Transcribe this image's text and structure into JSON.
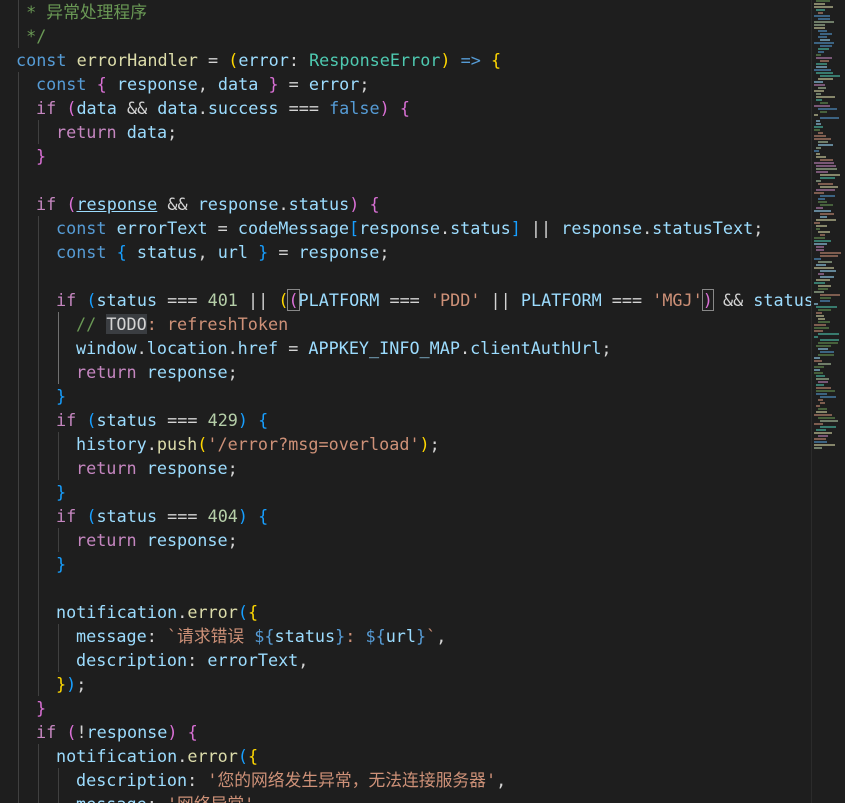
{
  "editor": {
    "lines": [
      {
        "indent": 0,
        "guides": [
          0
        ],
        "tokens": [
          {
            "t": " * 异常处理程序",
            "c": "cm"
          }
        ]
      },
      {
        "indent": 0,
        "guides": [
          0
        ],
        "tokens": [
          {
            "t": " */",
            "c": "cm"
          }
        ]
      },
      {
        "indent": 0,
        "guides": [],
        "tokens": [
          {
            "t": "const",
            "c": "kw"
          },
          {
            "t": " "
          },
          {
            "t": "errorHandler",
            "c": "fn"
          },
          {
            "t": " = "
          },
          {
            "t": "(",
            "c": "p1"
          },
          {
            "t": "error",
            "c": "var"
          },
          {
            "t": ": "
          },
          {
            "t": "ResponseError",
            "c": "type"
          },
          {
            "t": ")",
            "c": "p1"
          },
          {
            "t": " "
          },
          {
            "t": "=>",
            "c": "kw"
          },
          {
            "t": " "
          },
          {
            "t": "{",
            "c": "p1"
          }
        ]
      },
      {
        "indent": 1,
        "guides": [
          0
        ],
        "tokens": [
          {
            "t": "const",
            "c": "kw"
          },
          {
            "t": " "
          },
          {
            "t": "{",
            "c": "p2"
          },
          {
            "t": " "
          },
          {
            "t": "response",
            "c": "var"
          },
          {
            "t": ", "
          },
          {
            "t": "data",
            "c": "var"
          },
          {
            "t": " "
          },
          {
            "t": "}",
            "c": "p2"
          },
          {
            "t": " = "
          },
          {
            "t": "error",
            "c": "var"
          },
          {
            "t": ";"
          }
        ]
      },
      {
        "indent": 1,
        "guides": [
          0
        ],
        "tokens": [
          {
            "t": "if",
            "c": "ctl"
          },
          {
            "t": " "
          },
          {
            "t": "(",
            "c": "p2"
          },
          {
            "t": "data",
            "c": "var"
          },
          {
            "t": " && "
          },
          {
            "t": "data",
            "c": "var"
          },
          {
            "t": "."
          },
          {
            "t": "success",
            "c": "var"
          },
          {
            "t": " === "
          },
          {
            "t": "false",
            "c": "kw"
          },
          {
            "t": ")",
            "c": "p2"
          },
          {
            "t": " "
          },
          {
            "t": "{",
            "c": "p2"
          }
        ]
      },
      {
        "indent": 2,
        "guides": [
          0,
          1
        ],
        "tokens": [
          {
            "t": "return",
            "c": "ctl"
          },
          {
            "t": " "
          },
          {
            "t": "data",
            "c": "var"
          },
          {
            "t": ";"
          }
        ]
      },
      {
        "indent": 1,
        "guides": [
          0
        ],
        "tokens": [
          {
            "t": "}",
            "c": "p2"
          }
        ]
      },
      {
        "indent": 0,
        "guides": [
          0
        ],
        "tokens": []
      },
      {
        "indent": 1,
        "guides": [
          0
        ],
        "tokens": [
          {
            "t": "if",
            "c": "ctl"
          },
          {
            "t": " "
          },
          {
            "t": "(",
            "c": "p2"
          },
          {
            "t": "response",
            "c": "var",
            "u": true
          },
          {
            "t": " && "
          },
          {
            "t": "response",
            "c": "var"
          },
          {
            "t": "."
          },
          {
            "t": "status",
            "c": "var"
          },
          {
            "t": ")",
            "c": "p2"
          },
          {
            "t": " "
          },
          {
            "t": "{",
            "c": "p2"
          }
        ]
      },
      {
        "indent": 2,
        "guides": [
          0,
          1
        ],
        "tokens": [
          {
            "t": "const",
            "c": "kw"
          },
          {
            "t": " "
          },
          {
            "t": "errorText",
            "c": "var"
          },
          {
            "t": " = "
          },
          {
            "t": "codeMessage",
            "c": "var"
          },
          {
            "t": "[",
            "c": "p3"
          },
          {
            "t": "response",
            "c": "var"
          },
          {
            "t": "."
          },
          {
            "t": "status",
            "c": "var"
          },
          {
            "t": "]",
            "c": "p3"
          },
          {
            "t": " || "
          },
          {
            "t": "response",
            "c": "var"
          },
          {
            "t": "."
          },
          {
            "t": "statusText",
            "c": "var"
          },
          {
            "t": ";"
          }
        ]
      },
      {
        "indent": 2,
        "guides": [
          0,
          1
        ],
        "tokens": [
          {
            "t": "const",
            "c": "kw"
          },
          {
            "t": " "
          },
          {
            "t": "{",
            "c": "p3"
          },
          {
            "t": " "
          },
          {
            "t": "status",
            "c": "var"
          },
          {
            "t": ", "
          },
          {
            "t": "url",
            "c": "var"
          },
          {
            "t": " "
          },
          {
            "t": "}",
            "c": "p3"
          },
          {
            "t": " = "
          },
          {
            "t": "response",
            "c": "var"
          },
          {
            "t": ";"
          }
        ]
      },
      {
        "indent": 0,
        "guides": [
          0,
          1
        ],
        "tokens": []
      },
      {
        "indent": 2,
        "guides": [
          0,
          1
        ],
        "tokens": [
          {
            "t": "if",
            "c": "ctl"
          },
          {
            "t": " "
          },
          {
            "t": "(",
            "c": "p3"
          },
          {
            "t": "status",
            "c": "var"
          },
          {
            "t": " === "
          },
          {
            "t": "401",
            "c": "num"
          },
          {
            "t": " || "
          },
          {
            "t": "(",
            "c": "p1"
          },
          {
            "t": "(",
            "c": "p2",
            "m": true
          },
          {
            "t": "PLATFORM",
            "c": "var"
          },
          {
            "t": " === "
          },
          {
            "t": "'PDD'",
            "c": "str"
          },
          {
            "t": " || "
          },
          {
            "t": "PLATFORM",
            "c": "var"
          },
          {
            "t": " === "
          },
          {
            "t": "'MGJ'",
            "c": "str"
          },
          {
            "t": ")",
            "c": "p2",
            "m": true
          },
          {
            "t": " && "
          },
          {
            "t": "status",
            "c": "var"
          },
          {
            "t": " === "
          }
        ]
      },
      {
        "indent": 3,
        "guides": [
          0,
          1,
          2
        ],
        "tokens": [
          {
            "t": "// ",
            "c": "cm"
          },
          {
            "t": "TODO",
            "c": "todo"
          },
          {
            "t": ": refreshToken",
            "c": "str"
          }
        ]
      },
      {
        "indent": 3,
        "guides": [
          0,
          1,
          2
        ],
        "tokens": [
          {
            "t": "window",
            "c": "var"
          },
          {
            "t": "."
          },
          {
            "t": "location",
            "c": "var"
          },
          {
            "t": "."
          },
          {
            "t": "href",
            "c": "var"
          },
          {
            "t": " = "
          },
          {
            "t": "APPKEY_INFO_MAP",
            "c": "var"
          },
          {
            "t": "."
          },
          {
            "t": "clientAuthUrl",
            "c": "var"
          },
          {
            "t": ";"
          }
        ]
      },
      {
        "indent": 3,
        "guides": [
          0,
          1,
          2
        ],
        "tokens": [
          {
            "t": "return",
            "c": "ctl"
          },
          {
            "t": " "
          },
          {
            "t": "response",
            "c": "var"
          },
          {
            "t": ";"
          }
        ]
      },
      {
        "indent": 2,
        "guides": [
          0,
          1
        ],
        "tokens": [
          {
            "t": "}",
            "c": "p3"
          }
        ]
      },
      {
        "indent": 2,
        "guides": [
          0,
          1
        ],
        "tokens": [
          {
            "t": "if",
            "c": "ctl"
          },
          {
            "t": " "
          },
          {
            "t": "(",
            "c": "p3"
          },
          {
            "t": "status",
            "c": "var"
          },
          {
            "t": " === "
          },
          {
            "t": "429",
            "c": "num"
          },
          {
            "t": ")",
            "c": "p3"
          },
          {
            "t": " "
          },
          {
            "t": "{",
            "c": "p3"
          }
        ]
      },
      {
        "indent": 3,
        "guides": [
          0,
          1,
          2
        ],
        "tokens": [
          {
            "t": "history",
            "c": "var"
          },
          {
            "t": "."
          },
          {
            "t": "push",
            "c": "fn"
          },
          {
            "t": "(",
            "c": "p1"
          },
          {
            "t": "'/error?msg=overload'",
            "c": "str"
          },
          {
            "t": ")",
            "c": "p1"
          },
          {
            "t": ";"
          }
        ]
      },
      {
        "indent": 3,
        "guides": [
          0,
          1,
          2
        ],
        "tokens": [
          {
            "t": "return",
            "c": "ctl"
          },
          {
            "t": " "
          },
          {
            "t": "response",
            "c": "var"
          },
          {
            "t": ";"
          }
        ]
      },
      {
        "indent": 2,
        "guides": [
          0,
          1
        ],
        "tokens": [
          {
            "t": "}",
            "c": "p3"
          }
        ]
      },
      {
        "indent": 2,
        "guides": [
          0,
          1
        ],
        "tokens": [
          {
            "t": "if",
            "c": "ctl"
          },
          {
            "t": " "
          },
          {
            "t": "(",
            "c": "p3"
          },
          {
            "t": "status",
            "c": "var"
          },
          {
            "t": " === "
          },
          {
            "t": "404",
            "c": "num"
          },
          {
            "t": ")",
            "c": "p3"
          },
          {
            "t": " "
          },
          {
            "t": "{",
            "c": "p3"
          }
        ]
      },
      {
        "indent": 3,
        "guides": [
          0,
          1,
          2
        ],
        "tokens": [
          {
            "t": "return",
            "c": "ctl"
          },
          {
            "t": " "
          },
          {
            "t": "response",
            "c": "var"
          },
          {
            "t": ";"
          }
        ]
      },
      {
        "indent": 2,
        "guides": [
          0,
          1
        ],
        "tokens": [
          {
            "t": "}",
            "c": "p3"
          }
        ]
      },
      {
        "indent": 0,
        "guides": [
          0,
          1
        ],
        "tokens": []
      },
      {
        "indent": 2,
        "guides": [
          0,
          1
        ],
        "tokens": [
          {
            "t": "notification",
            "c": "var"
          },
          {
            "t": "."
          },
          {
            "t": "error",
            "c": "fn"
          },
          {
            "t": "(",
            "c": "p3"
          },
          {
            "t": "{",
            "c": "p1"
          }
        ]
      },
      {
        "indent": 3,
        "guides": [
          0,
          1,
          2
        ],
        "tokens": [
          {
            "t": "message",
            "c": "var"
          },
          {
            "t": ": "
          },
          {
            "t": "`请求错误 ",
            "c": "str"
          },
          {
            "t": "${",
            "c": "kw"
          },
          {
            "t": "status",
            "c": "var"
          },
          {
            "t": "}",
            "c": "kw"
          },
          {
            "t": ": ",
            "c": "str"
          },
          {
            "t": "${",
            "c": "kw"
          },
          {
            "t": "url",
            "c": "var"
          },
          {
            "t": "}",
            "c": "kw"
          },
          {
            "t": "`",
            "c": "str"
          },
          {
            "t": ","
          }
        ]
      },
      {
        "indent": 3,
        "guides": [
          0,
          1,
          2
        ],
        "tokens": [
          {
            "t": "description",
            "c": "var"
          },
          {
            "t": ": "
          },
          {
            "t": "errorText",
            "c": "var"
          },
          {
            "t": ","
          }
        ]
      },
      {
        "indent": 2,
        "guides": [
          0,
          1
        ],
        "tokens": [
          {
            "t": "}",
            "c": "p1"
          },
          {
            "t": ")",
            "c": "p3"
          },
          {
            "t": ";"
          }
        ]
      },
      {
        "indent": 1,
        "guides": [
          0
        ],
        "tokens": [
          {
            "t": "}",
            "c": "p2"
          }
        ]
      },
      {
        "indent": 1,
        "guides": [
          0
        ],
        "tokens": [
          {
            "t": "if",
            "c": "ctl"
          },
          {
            "t": " "
          },
          {
            "t": "(",
            "c": "p2"
          },
          {
            "t": "!"
          },
          {
            "t": "response",
            "c": "var"
          },
          {
            "t": ")",
            "c": "p2"
          },
          {
            "t": " "
          },
          {
            "t": "{",
            "c": "p2"
          }
        ]
      },
      {
        "indent": 2,
        "guides": [
          0,
          1
        ],
        "tokens": [
          {
            "t": "notification",
            "c": "var"
          },
          {
            "t": "."
          },
          {
            "t": "error",
            "c": "fn"
          },
          {
            "t": "(",
            "c": "p3"
          },
          {
            "t": "{",
            "c": "p1"
          }
        ]
      },
      {
        "indent": 3,
        "guides": [
          0,
          1,
          2
        ],
        "tokens": [
          {
            "t": "description",
            "c": "var"
          },
          {
            "t": ": "
          },
          {
            "t": "'您的网络发生异常，无法连接服务器'",
            "c": "str"
          },
          {
            "t": ","
          }
        ]
      },
      {
        "indent": 3,
        "guides": [
          0,
          1,
          2
        ],
        "tokens": [
          {
            "t": "message",
            "c": "var"
          },
          {
            "t": ": "
          },
          {
            "t": "'网络异常'",
            "c": "str"
          },
          {
            "t": ","
          }
        ]
      }
    ]
  },
  "colors": {
    "background": "#1e1e1e",
    "keyword": "#569cd6",
    "control": "#c586c0",
    "variable": "#9cdcfe",
    "function": "#dcdcaa",
    "type": "#4ec9b0",
    "string": "#ce9178",
    "number": "#b5cea8",
    "comment": "#6a9955"
  }
}
